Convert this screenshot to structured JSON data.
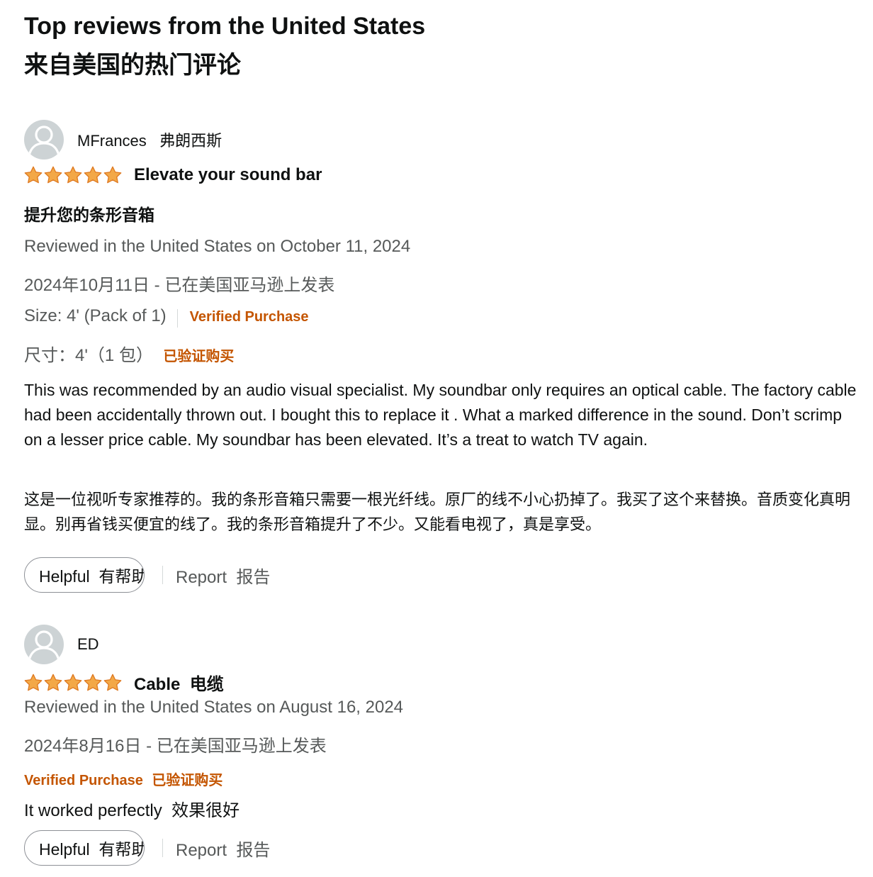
{
  "header": {
    "title_en": "Top reviews from the United States",
    "title_zh": "来自美国的热门评论"
  },
  "icons": {
    "avatar": "user-avatar-icon",
    "star": "star-filled-icon"
  },
  "colors": {
    "star": "#f3a847",
    "verified": "#c45500",
    "meta_text": "#565959",
    "avatar_bg": "#cdd3d5"
  },
  "reviews": [
    {
      "profile_name": "MFrances   弗朗西斯",
      "rating": 5,
      "title": "Elevate your sound bar",
      "title_zh": "提升您的条形音箱",
      "date": "Reviewed in the United States on October 11, 2024",
      "date_zh": "2024年10月11日 - 已在美国亚马逊上发表",
      "variant": "Size: 4' (Pack of 1)",
      "verified": "Verified Purchase",
      "variant_zh": "尺寸：4'（1 包）",
      "verified_zh": "已验证购买",
      "body": "This was recommended by an audio visual specialist. My soundbar only requires an optical cable. The factory cable had been accidentally thrown out. I bought this to replace it . What a marked difference in the sound. Don’t scrimp on a lesser price cable. My soundbar has been elevated. It’s a treat to watch TV again.",
      "body_zh": "这是一位视听专家推荐的。我的条形音箱只需要一根光纤线。原厂的线不小心扔掉了。我买了这个来替换。音质变化真明显。别再省钱买便宜的线了。我的条形音箱提升了不少。又能看电视了，真是享受。",
      "helpful": "Helpful  有帮助",
      "report": "Report  报告"
    },
    {
      "profile_name": "ED",
      "rating": 5,
      "title": "Cable  电缆",
      "date": "Reviewed in the United States on August 16, 2024",
      "date_zh": "2024年8月16日 - 已在美国亚马逊上发表",
      "verified": "Verified Purchase",
      "verified_zh": "已验证购买",
      "body": "It worked perfectly  效果很好",
      "helpful": "Helpful  有帮助",
      "report": "Report  报告"
    }
  ]
}
